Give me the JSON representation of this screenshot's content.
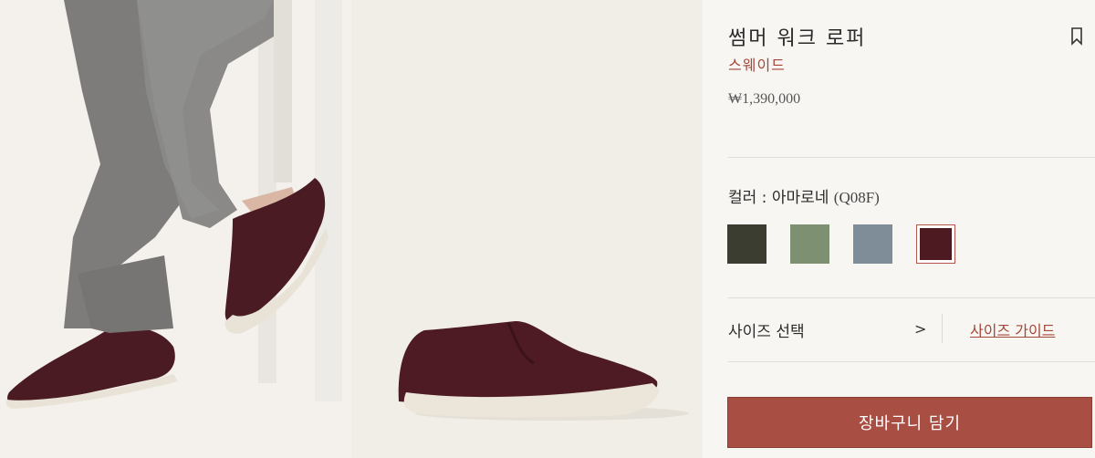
{
  "gallery": {
    "images": [
      {
        "alt": "model-wearing-loafers"
      },
      {
        "alt": "loafer-side-view"
      }
    ]
  },
  "product": {
    "title": "썸머 워크 로퍼",
    "material": "스웨이드",
    "price": "₩1,390,000"
  },
  "color": {
    "label_prefix": "컬러 : 아마로네 ",
    "code": "(Q08F)",
    "swatches": [
      {
        "name": "dark-olive",
        "color": "#3b3d31"
      },
      {
        "name": "sage-green",
        "color": "#7d9172"
      },
      {
        "name": "slate-blue",
        "color": "#7f8d98"
      },
      {
        "name": "amarone",
        "color": "#4d1a22",
        "selected": true
      }
    ]
  },
  "size": {
    "label": "사이즈 선택",
    "chevron": ">",
    "guide_label": "사이즈 가이드"
  },
  "cart": {
    "label": "장바구니 담기"
  },
  "colors": {
    "accent": "#a84e43",
    "accent_text": "#a44638"
  }
}
